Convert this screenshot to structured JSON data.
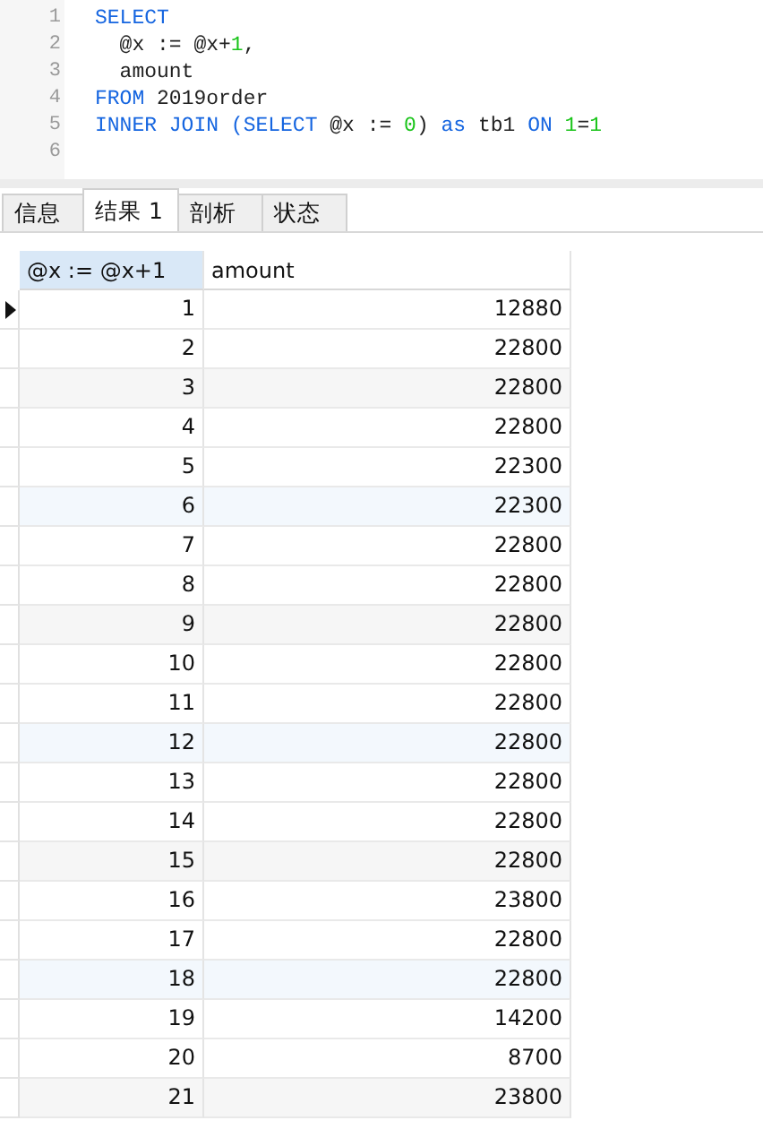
{
  "editor": {
    "lines": [
      {
        "number": "1",
        "tokens": [
          {
            "kind": "keyword",
            "text": "SELECT"
          }
        ]
      },
      {
        "number": "2",
        "tokens": [
          {
            "kind": "plain",
            "text": "  @x := @x+"
          },
          {
            "kind": "number",
            "text": "1"
          },
          {
            "kind": "plain",
            "text": ","
          }
        ]
      },
      {
        "number": "3",
        "tokens": [
          {
            "kind": "plain",
            "text": "  amount"
          }
        ]
      },
      {
        "number": "4",
        "tokens": [
          {
            "kind": "keyword",
            "text": "FROM"
          },
          {
            "kind": "plain",
            "text": " 2019order"
          }
        ]
      },
      {
        "number": "5",
        "tokens": [
          {
            "kind": "keyword",
            "text": "INNER JOIN (SELECT"
          },
          {
            "kind": "plain",
            "text": " @x := "
          },
          {
            "kind": "number",
            "text": "0"
          },
          {
            "kind": "plain",
            "text": ") "
          },
          {
            "kind": "keyword",
            "text": "as"
          },
          {
            "kind": "plain",
            "text": " tb1 "
          },
          {
            "kind": "keyword",
            "text": "ON"
          },
          {
            "kind": "number",
            "text": " 1"
          },
          {
            "kind": "plain",
            "text": "="
          },
          {
            "kind": "number",
            "text": "1"
          }
        ]
      },
      {
        "number": "6"
      }
    ]
  },
  "tabs": [
    {
      "label": "信息",
      "selected": false
    },
    {
      "label": "结果 1",
      "selected": true
    },
    {
      "label": "剖析",
      "selected": false
    },
    {
      "label": "状态",
      "selected": false
    }
  ],
  "table": {
    "columns": [
      {
        "label": "@x := @x+1",
        "selected": true
      },
      {
        "label": "amount",
        "selected": false
      }
    ],
    "rows": [
      {
        "cells": [
          "1",
          "12880"
        ],
        "current": true,
        "kind": "plain"
      },
      {
        "cells": [
          "2",
          "22800"
        ],
        "current": false,
        "kind": "plain"
      },
      {
        "cells": [
          "3",
          "22800"
        ],
        "current": false,
        "kind": "grey"
      },
      {
        "cells": [
          "4",
          "22800"
        ],
        "current": false,
        "kind": "plain"
      },
      {
        "cells": [
          "5",
          "22300"
        ],
        "current": false,
        "kind": "plain"
      },
      {
        "cells": [
          "6",
          "22300"
        ],
        "current": false,
        "kind": "blue"
      },
      {
        "cells": [
          "7",
          "22800"
        ],
        "current": false,
        "kind": "plain"
      },
      {
        "cells": [
          "8",
          "22800"
        ],
        "current": false,
        "kind": "plain"
      },
      {
        "cells": [
          "9",
          "22800"
        ],
        "current": false,
        "kind": "grey"
      },
      {
        "cells": [
          "10",
          "22800"
        ],
        "current": false,
        "kind": "plain"
      },
      {
        "cells": [
          "11",
          "22800"
        ],
        "current": false,
        "kind": "plain"
      },
      {
        "cells": [
          "12",
          "22800"
        ],
        "current": false,
        "kind": "blue"
      },
      {
        "cells": [
          "13",
          "22800"
        ],
        "current": false,
        "kind": "plain"
      },
      {
        "cells": [
          "14",
          "22800"
        ],
        "current": false,
        "kind": "plain"
      },
      {
        "cells": [
          "15",
          "22800"
        ],
        "current": false,
        "kind": "grey"
      },
      {
        "cells": [
          "16",
          "23800"
        ],
        "current": false,
        "kind": "plain"
      },
      {
        "cells": [
          "17",
          "22800"
        ],
        "current": false,
        "kind": "plain"
      },
      {
        "cells": [
          "18",
          "22800"
        ],
        "current": false,
        "kind": "blue"
      },
      {
        "cells": [
          "19",
          "14200"
        ],
        "current": false,
        "kind": "plain"
      },
      {
        "cells": [
          "20",
          "8700"
        ],
        "current": false,
        "kind": "plain"
      },
      {
        "cells": [
          "21",
          "23800"
        ],
        "current": false,
        "kind": "grey"
      }
    ]
  }
}
